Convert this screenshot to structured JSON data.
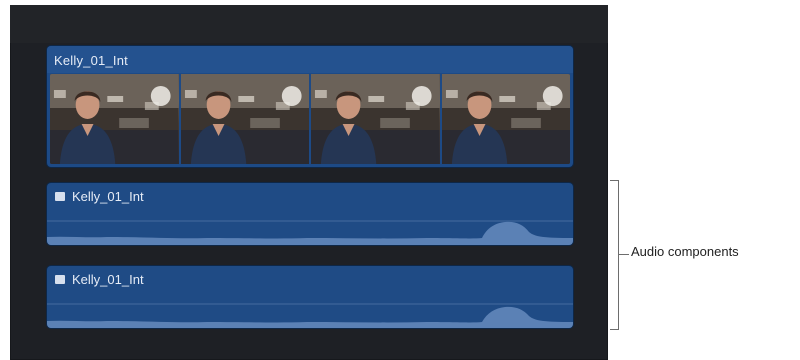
{
  "timeline": {
    "video_clip": {
      "title": "Kelly_01_Int",
      "frame_count": 4
    },
    "audio_clips": [
      {
        "title": "Kelly_01_Int",
        "icon": "audio-component-icon"
      },
      {
        "title": "Kelly_01_Int",
        "icon": "audio-component-icon"
      }
    ]
  },
  "annotation": {
    "label": "Audio components"
  },
  "colors": {
    "timeline_bg": "#1e2025",
    "clip_blue": "#1d4a86",
    "waveform_fill": "#5f84b7",
    "annotation_line": "#6d6d6d"
  }
}
